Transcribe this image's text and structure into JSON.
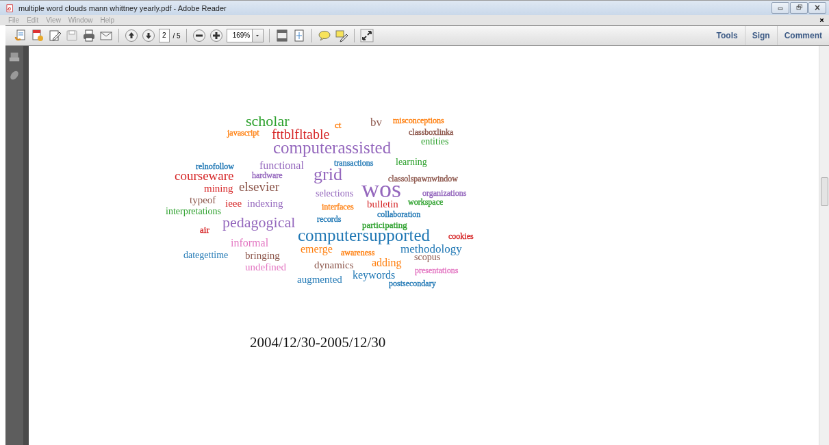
{
  "window": {
    "title": "multiple word clouds mann whittney yearly.pdf - Adobe Reader"
  },
  "menu": [
    "File",
    "Edit",
    "View",
    "Window",
    "Help"
  ],
  "toolbar": {
    "page": "2",
    "page_total": "/ 5",
    "zoom": "169%",
    "panes": [
      "Tools",
      "Sign",
      "Comment"
    ]
  },
  "word_cloud": [
    {
      "text": "scholar",
      "color": "#2ca02c"
    },
    {
      "text": "ct",
      "color": "#ff7f0e"
    },
    {
      "text": "bv",
      "color": "#8c564b"
    },
    {
      "text": "misconceptions",
      "color": "#ff7f0e"
    },
    {
      "text": "javascript",
      "color": "#ff7f0e"
    },
    {
      "text": "fttblfltable",
      "color": "#d62728"
    },
    {
      "text": "classboxlinka",
      "color": "#8c564b"
    },
    {
      "text": "computerassisted",
      "color": "#9467bd"
    },
    {
      "text": "entities",
      "color": "#2ca02c"
    },
    {
      "text": "relnofollow",
      "color": "#1f77b4"
    },
    {
      "text": "functional",
      "color": "#9467bd"
    },
    {
      "text": "transactions",
      "color": "#1f77b4"
    },
    {
      "text": "learning",
      "color": "#2ca02c"
    },
    {
      "text": "courseware",
      "color": "#d62728"
    },
    {
      "text": "hardware",
      "color": "#9467bd"
    },
    {
      "text": "grid",
      "color": "#9467bd"
    },
    {
      "text": "classolspawnwindow",
      "color": "#8c564b"
    },
    {
      "text": "mining",
      "color": "#d62728"
    },
    {
      "text": "elsevier",
      "color": "#8c564b"
    },
    {
      "text": "selections",
      "color": "#9467bd"
    },
    {
      "text": "wos",
      "color": "#9467bd"
    },
    {
      "text": "organizations",
      "color": "#9467bd"
    },
    {
      "text": "typeof",
      "color": "#8c564b"
    },
    {
      "text": "ieee",
      "color": "#d62728"
    },
    {
      "text": "indexing",
      "color": "#9467bd"
    },
    {
      "text": "bulletin",
      "color": "#d62728"
    },
    {
      "text": "workspace",
      "color": "#2ca02c"
    },
    {
      "text": "interfaces",
      "color": "#ff7f0e"
    },
    {
      "text": "interpretations",
      "color": "#2ca02c"
    },
    {
      "text": "collaboration",
      "color": "#1f77b4"
    },
    {
      "text": "air",
      "color": "#d62728"
    },
    {
      "text": "pedagogical",
      "color": "#9467bd"
    },
    {
      "text": "records",
      "color": "#1f77b4"
    },
    {
      "text": "participating",
      "color": "#2ca02c"
    },
    {
      "text": "computersupported",
      "color": "#1f77b4"
    },
    {
      "text": "cookies",
      "color": "#d62728"
    },
    {
      "text": "informal",
      "color": "#e377c2"
    },
    {
      "text": "dategettime",
      "color": "#1f77b4"
    },
    {
      "text": "bringing",
      "color": "#8c564b"
    },
    {
      "text": "emerge",
      "color": "#ff7f0e"
    },
    {
      "text": "awareness",
      "color": "#ff7f0e"
    },
    {
      "text": "methodology",
      "color": "#1f77b4"
    },
    {
      "text": "undefined",
      "color": "#e377c2"
    },
    {
      "text": "dynamics",
      "color": "#8c564b"
    },
    {
      "text": "adding",
      "color": "#ff7f0e"
    },
    {
      "text": "scopus",
      "color": "#8c564b"
    },
    {
      "text": "augmented",
      "color": "#1f77b4"
    },
    {
      "text": "keywords",
      "color": "#1f77b4"
    },
    {
      "text": "presentations",
      "color": "#e377c2"
    },
    {
      "text": "postsecondary",
      "color": "#1f77b4"
    }
  ],
  "date_range": "2004/12/30-2005/12/30"
}
